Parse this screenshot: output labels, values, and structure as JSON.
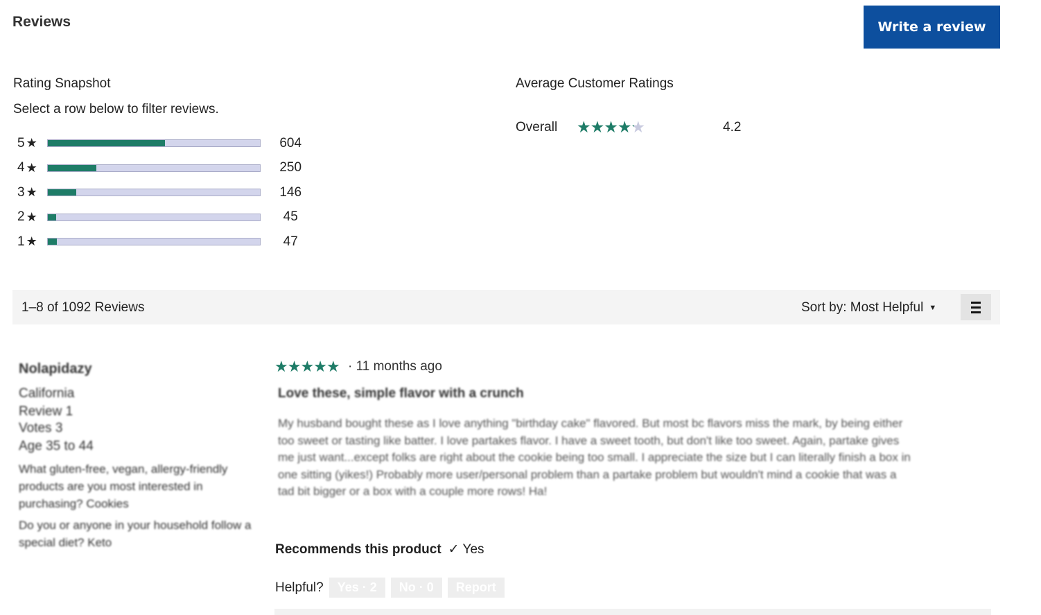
{
  "header": {
    "title": "Reviews",
    "write_button": "Write a review"
  },
  "snapshot": {
    "title": "Rating Snapshot",
    "subtitle": "Select a row below to filter reviews.",
    "rows": [
      {
        "stars": "5",
        "count": "604",
        "fraction": 0.553
      },
      {
        "stars": "4",
        "count": "250",
        "fraction": 0.229
      },
      {
        "stars": "3",
        "count": "146",
        "fraction": 0.134
      },
      {
        "stars": "2",
        "count": "45",
        "fraction": 0.041
      },
      {
        "stars": "1",
        "count": "47",
        "fraction": 0.043
      }
    ],
    "star_symbol": "★"
  },
  "averages": {
    "title": "Average Customer Ratings",
    "overall_label": "Overall",
    "overall_rating": 4.2,
    "overall_value": "4.2"
  },
  "toolbar": {
    "count_text": "1–8 of 1092 Reviews",
    "sort_text": "Sort by: Most Helpful"
  },
  "review": {
    "rating": 5,
    "date": "· 11 months ago",
    "reviewer": {
      "name": "Nolapidazy",
      "location": "California",
      "reviews": "Review 1",
      "votes": "Votes 3",
      "age": "Age 35 to 44",
      "q1": "What gluten-free, vegan, allergy-friendly products are you most interested in purchasing? Cookies",
      "q2": "Do you or anyone in your household follow a special diet? Keto"
    },
    "title": "Love these, simple flavor with a crunch",
    "body": "My husband bought these as I love anything \"birthday cake\" flavored. But most bc flavors miss the mark, by being either too sweet or tasting like batter. I love partakes flavor. I have a sweet tooth, but don't like too sweet. Again, partake gives me just want...except folks are right about the cookie being too small. I appreciate the size but I can literally finish a box in one sitting (yikes!) Probably more user/personal problem than a partake problem but wouldn't mind a cookie that was a tad bit bigger or a box with a couple more rows! Ha!",
    "recommends_label": "Recommends this product",
    "recommends_check": "✓",
    "recommends_value": "Yes",
    "helpful_label": "Helpful?",
    "yes_button": "Yes · 2",
    "no_button": "No · 0",
    "report_button": "Report"
  },
  "colors": {
    "accent": "#1e7c67",
    "button": "#0d4f9e",
    "bar_track": "#d3d5ec"
  }
}
